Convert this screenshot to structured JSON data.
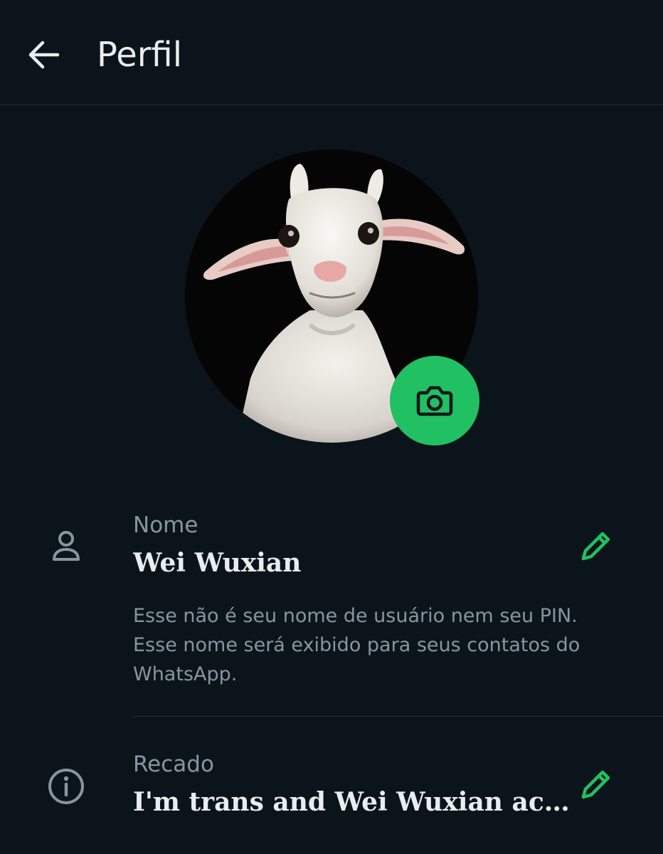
{
  "header": {
    "title": "Perfil",
    "back_icon": "arrow-left-icon"
  },
  "profile": {
    "photo": "goat-avatar",
    "camera_icon": "camera-icon",
    "camera_color": "#21c063"
  },
  "name_field": {
    "icon": "person-icon",
    "label": "Nome",
    "value": "Wei Wuxian",
    "hint": "Esse não é seu nome de usuário nem seu PIN. Esse nome será exibido para seus contatos do WhatsApp.",
    "edit_icon": "pencil-icon"
  },
  "about_field": {
    "icon": "info-icon",
    "label": "Recado",
    "value": "I'm trans and Wei Wuxian accepts me",
    "edit_icon": "pencil-icon"
  },
  "colors": {
    "background": "#0b141a",
    "accent": "#21c063",
    "primary_text": "#e9edef",
    "secondary_text": "#8696a0"
  }
}
